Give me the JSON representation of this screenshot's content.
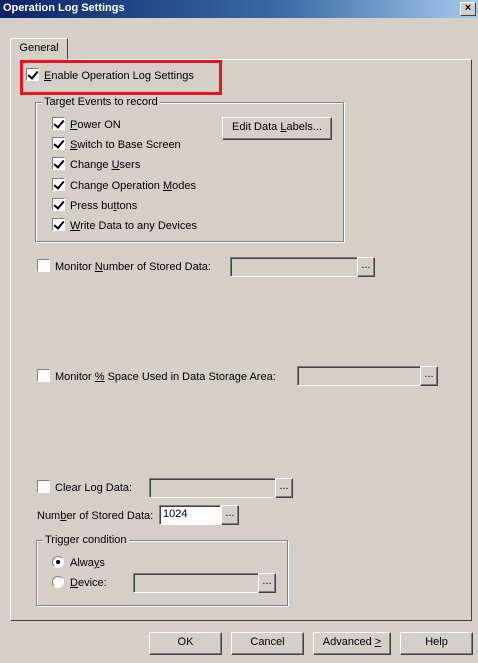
{
  "window": {
    "title": "Operation Log Settings",
    "close": "×"
  },
  "tabs": [
    {
      "label": "General"
    }
  ],
  "enable": {
    "prefix": "",
    "u": "E",
    "suffix": "nable Operation Log Settings",
    "checked": true
  },
  "target_group": {
    "title": "Target Events to record",
    "items": [
      {
        "pre": "",
        "u": "P",
        "post": "ower ON",
        "checked": true
      },
      {
        "pre": "",
        "u": "S",
        "post": "witch to Base Screen",
        "checked": true
      },
      {
        "pre": "Change ",
        "u": "U",
        "post": "sers",
        "checked": true
      },
      {
        "pre": "Change Operation ",
        "u": "M",
        "post": "odes",
        "checked": true
      },
      {
        "pre": "Press bu",
        "u": "t",
        "post": "tons",
        "checked": true
      },
      {
        "pre": "",
        "u": "W",
        "post": "rite Data to any Devices",
        "checked": true
      }
    ],
    "edit_button": {
      "pre": "Edit Data ",
      "u": "L",
      "post": "abels..."
    }
  },
  "monitor_number": {
    "pre": "Monitor ",
    "u": "N",
    "post": "umber of Stored Data:",
    "checked": false,
    "value": ""
  },
  "monitor_space": {
    "pre": "Monitor ",
    "u": "%",
    "post": " Space Used in Data Storage Area:",
    "checked": false,
    "value": ""
  },
  "clear_log": {
    "pre": "Clear Log Data:",
    "checked": false,
    "value": ""
  },
  "stored": {
    "pre": "Num",
    "u": "b",
    "post": "er of Stored Data:",
    "value": "1024"
  },
  "trigger": {
    "title": "Trigger condition",
    "always": {
      "pre": "Alwa",
      "u": "y",
      "post": "s",
      "selected": true
    },
    "device": {
      "pre": "",
      "u": "D",
      "post": "evice:",
      "selected": false,
      "value": ""
    }
  },
  "browse_label": "...",
  "footer": {
    "ok": "OK",
    "cancel": "Cancel",
    "advanced": {
      "pre": "Advanced ",
      "u": ">",
      "post": ""
    },
    "help": "Help"
  }
}
